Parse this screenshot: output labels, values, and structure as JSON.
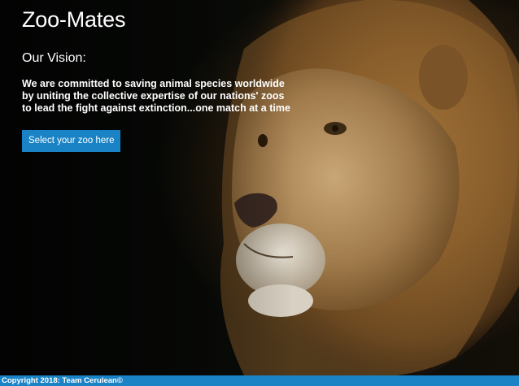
{
  "site": {
    "brand": "Zoo-Mates"
  },
  "vision": {
    "heading": "Our Vision:",
    "text": "We are committed to saving animal species worldwide by uniting the collective expertise of our nations' zoos to lead the fight against extinction...one match at a time"
  },
  "cta": {
    "label": "Select your zoo here"
  },
  "footer": {
    "copyright": "Copyright 2018: Team Cerulean©"
  },
  "colors": {
    "accent": "#1a83c6",
    "text": "#ffffff",
    "background": "#000000"
  },
  "icons": {
    "hero_image": "lion-photo"
  }
}
